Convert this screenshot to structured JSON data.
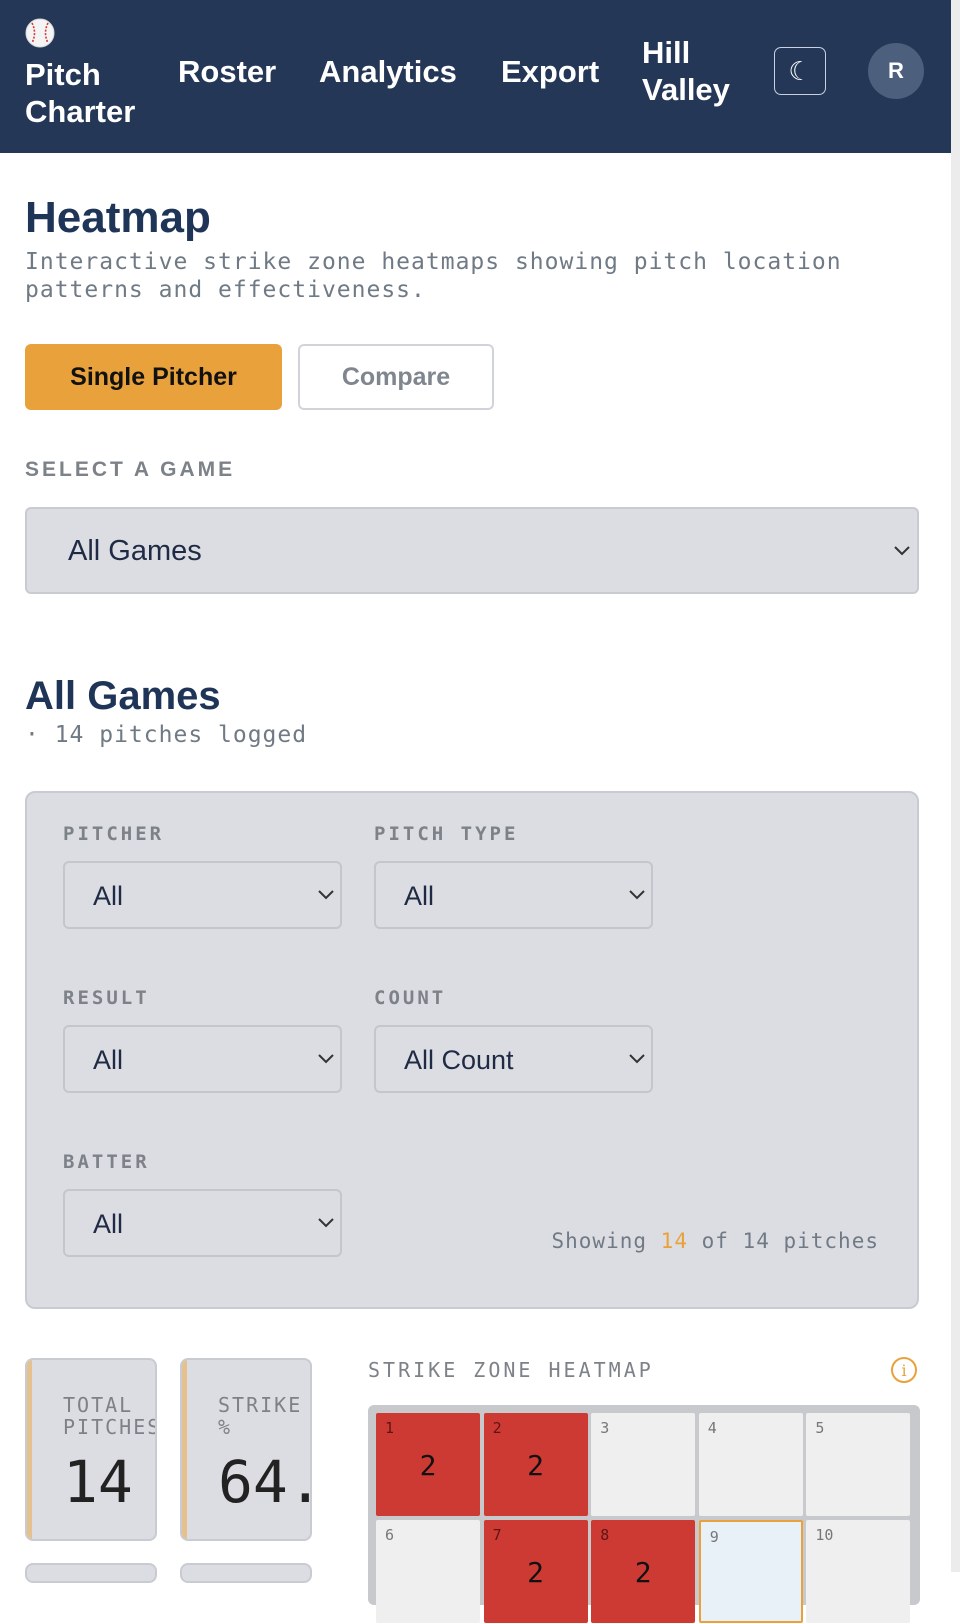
{
  "nav": {
    "brand_line1": "Pitch",
    "brand_line2": "Charter",
    "links": [
      "Roster",
      "Analytics",
      "Export"
    ],
    "team_line1": "Hill",
    "team_line2": "Valley",
    "theme_icon": "☾",
    "avatar_initial": "R"
  },
  "header": {
    "title": "Heatmap",
    "subtitle": "Interactive strike zone heatmaps showing pitch location patterns and effectiveness."
  },
  "modes": {
    "single_label": "Single Pitcher",
    "compare_label": "Compare",
    "active": "single"
  },
  "game_select": {
    "label": "SELECT A GAME",
    "value": "All Games"
  },
  "section": {
    "title": "All Games",
    "subtitle": "· 14 pitches logged"
  },
  "filters": {
    "pitcher": {
      "label": "PITCHER",
      "value": "All"
    },
    "pitch_type": {
      "label": "PITCH TYPE",
      "value": "All"
    },
    "result": {
      "label": "RESULT",
      "value": "All"
    },
    "count": {
      "label": "COUNT",
      "value": "All Count"
    },
    "batter": {
      "label": "BATTER",
      "value": "All"
    },
    "showing_prefix": "Showing",
    "showing_count": "14",
    "showing_suffix": "of 14 pitches"
  },
  "stats": {
    "total": {
      "label": "TOTAL\nPITCHES",
      "value": "14"
    },
    "strike": {
      "label": "STRIKE\n%",
      "value": "64."
    }
  },
  "heatmap": {
    "label": "STRIKE ZONE HEATMAP",
    "cells": [
      {
        "idx": "1",
        "count": "2",
        "state": "hot"
      },
      {
        "idx": "2",
        "count": "2",
        "state": "hot"
      },
      {
        "idx": "3",
        "count": "",
        "state": "empty"
      },
      {
        "idx": "4",
        "count": "",
        "state": "empty"
      },
      {
        "idx": "5",
        "count": "",
        "state": "empty"
      },
      {
        "idx": "6",
        "count": "",
        "state": "empty"
      },
      {
        "idx": "7",
        "count": "2",
        "state": "hot"
      },
      {
        "idx": "8",
        "count": "2",
        "state": "hot"
      },
      {
        "idx": "9",
        "count": "",
        "state": "selected"
      },
      {
        "idx": "10",
        "count": "",
        "state": "empty"
      }
    ]
  },
  "colors": {
    "nav_bg": "#243757",
    "accent": "#e9a23b",
    "hot": "#cd3a33"
  }
}
